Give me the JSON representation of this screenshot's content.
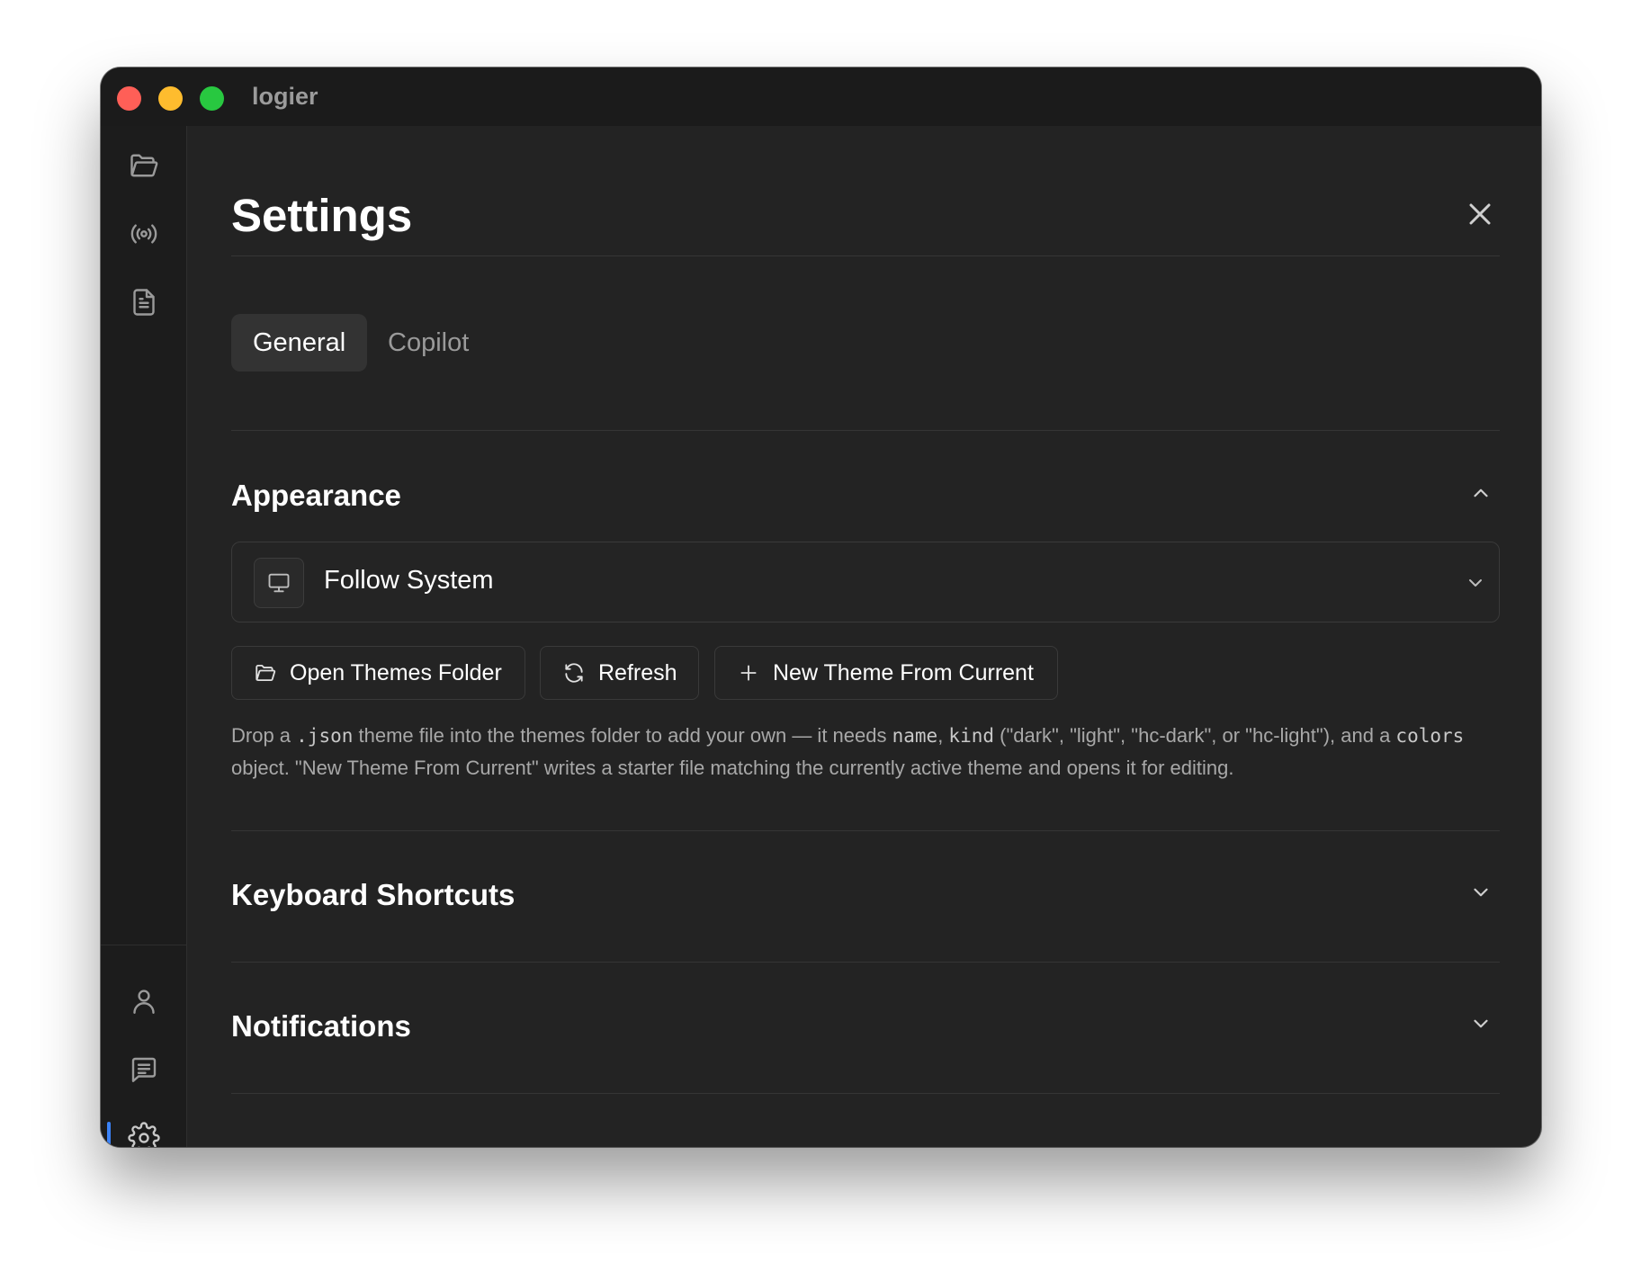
{
  "app": {
    "title": "logier"
  },
  "settings": {
    "title": "Settings",
    "tabs": [
      {
        "label": "General",
        "active": true
      },
      {
        "label": "Copilot",
        "active": false
      }
    ],
    "appearance": {
      "title": "Appearance",
      "theme_value": "Follow System",
      "buttons": {
        "open_folder": "Open Themes Folder",
        "refresh": "Refresh",
        "new_theme": "New Theme From Current"
      },
      "help": {
        "p1": "Drop a ",
        "c1": ".json",
        "p2": " theme file into the themes folder to add your own — it needs ",
        "c2": "name",
        "p3": ", ",
        "c3": "kind",
        "p4": " (\"dark\", \"light\", \"hc-dark\", or \"hc-light\"), and a ",
        "c4": "colors",
        "p5": " object. \"New Theme From Current\" writes a starter file matching the currently active theme and opens it for editing."
      }
    },
    "keyboard_shortcuts": {
      "title": "Keyboard Shortcuts"
    },
    "notifications": {
      "title": "Notifications"
    }
  },
  "colors": {
    "accent": "#3b82f6",
    "background": "#232323",
    "rail": "#1c1c1c"
  }
}
